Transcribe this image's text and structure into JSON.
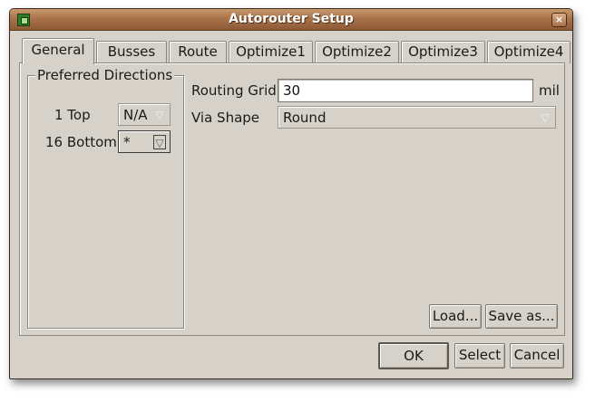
{
  "window": {
    "title": "Autorouter Setup",
    "close_glyph": "×",
    "icon": "eagle-app-icon"
  },
  "tabs": [
    {
      "label": "General",
      "active": true
    },
    {
      "label": "Busses",
      "active": false
    },
    {
      "label": "Route",
      "active": false
    },
    {
      "label": "Optimize1",
      "active": false
    },
    {
      "label": "Optimize2",
      "active": false
    },
    {
      "label": "Optimize3",
      "active": false
    },
    {
      "label": "Optimize4",
      "active": false
    }
  ],
  "preferred_directions": {
    "title": "Preferred Directions",
    "layers": [
      {
        "label": "1 Top",
        "value": "N/A"
      },
      {
        "label": "16 Bottom",
        "value": "*"
      }
    ]
  },
  "routing_grid": {
    "label": "Routing Grid",
    "value": "30",
    "unit": "mil"
  },
  "via_shape": {
    "label": "Via Shape",
    "value": "Round"
  },
  "panel_buttons": {
    "load": "Load...",
    "save_as": "Save as..."
  },
  "dialog_buttons": {
    "ok": "OK",
    "select": "Select",
    "cancel": "Cancel"
  },
  "icons": {
    "combo_arrow": "▽",
    "close": "close-icon"
  },
  "colors": {
    "titlebar": "#a9724a",
    "dialog_bg": "#d6d2c9",
    "input_bg": "#ffffff"
  }
}
